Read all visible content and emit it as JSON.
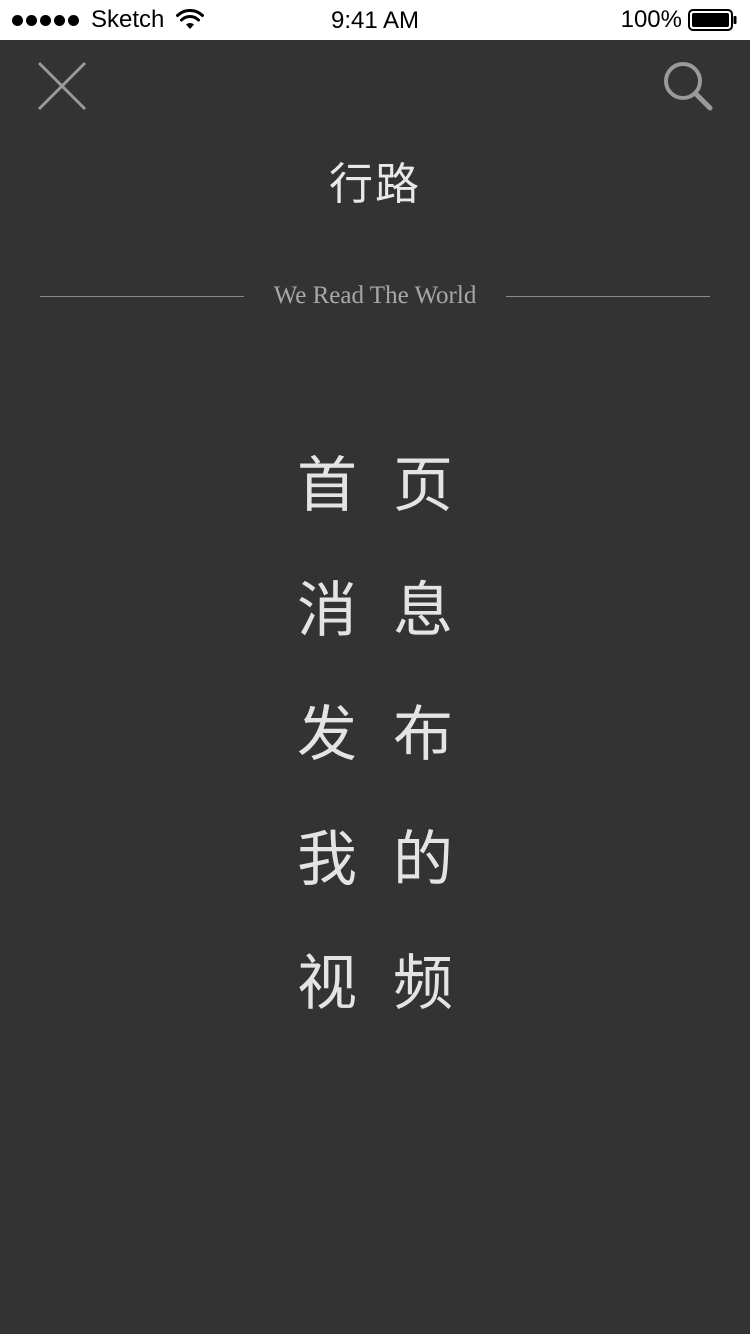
{
  "status_bar": {
    "carrier": "Sketch",
    "time": "9:41 AM",
    "battery": "100%",
    "signal_icon": "signal-dots-icon",
    "wifi_icon": "wifi-icon",
    "battery_icon": "battery-icon"
  },
  "header": {
    "close_icon": "close-icon",
    "search_icon": "search-icon",
    "title": "行路",
    "tagline": "We Read The World"
  },
  "menu": {
    "items": [
      {
        "chars": [
          "首",
          "页"
        ]
      },
      {
        "chars": [
          "消",
          "息"
        ]
      },
      {
        "chars": [
          "发",
          "布"
        ]
      },
      {
        "chars": [
          "我",
          "的"
        ]
      },
      {
        "chars": [
          "视",
          "频"
        ]
      }
    ]
  },
  "colors": {
    "background": "#333333",
    "text": "#e4e4e4",
    "muted": "#a8a8a8",
    "divider": "#8a8a8a"
  }
}
